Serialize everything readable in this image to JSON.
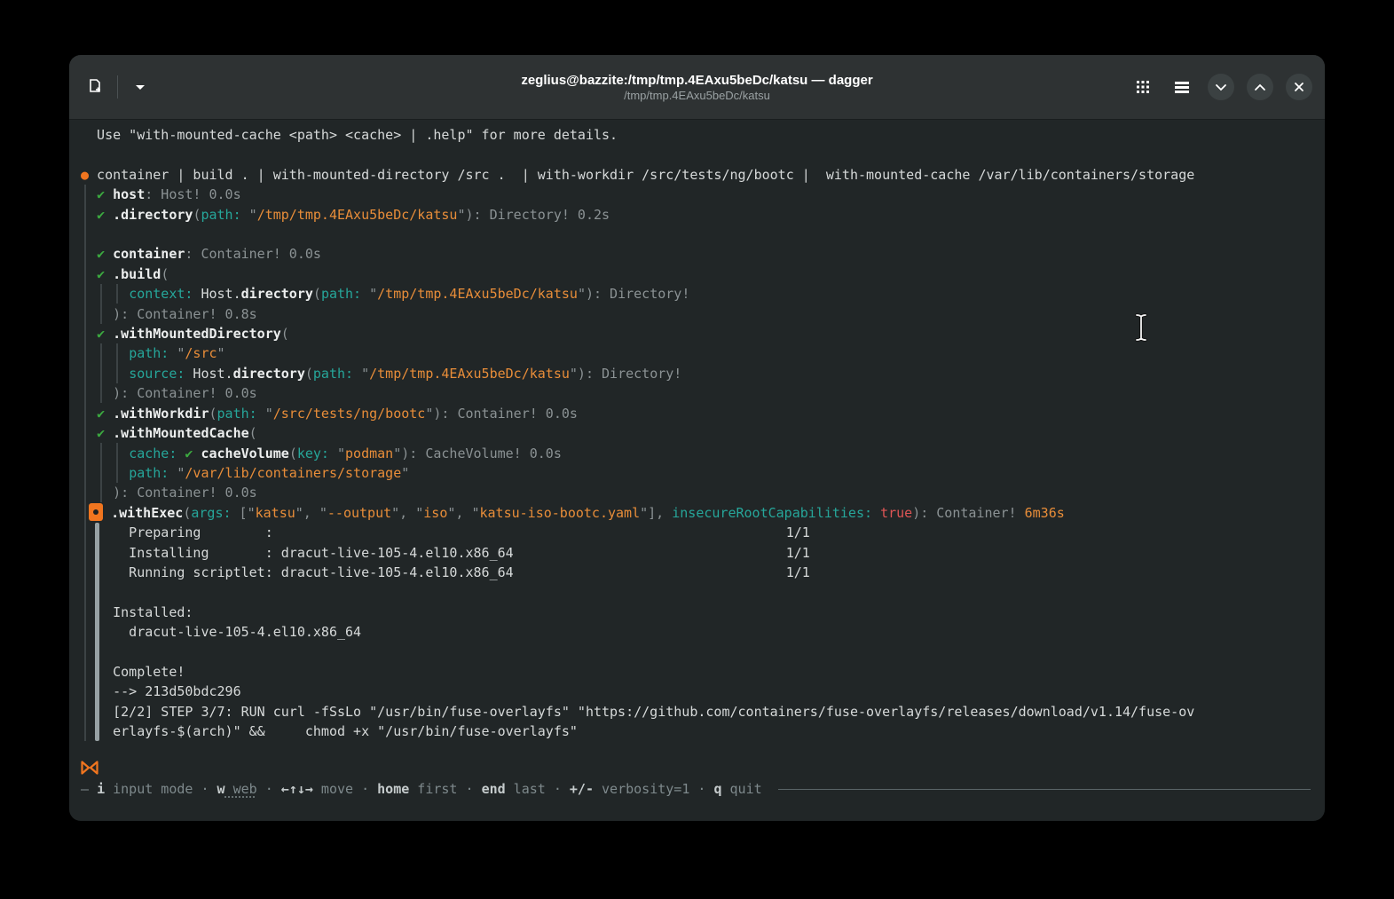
{
  "titlebar": {
    "title": "zeglius@bazzite:/tmp/tmp.4EAxu5beDc/katsu — dagger",
    "subtitle": "/tmp/tmp.4EAxu5beDc/katsu"
  },
  "colors": {
    "terminal_bg": "#212627",
    "titlebar_bg": "#2e3233",
    "fg_text": "#d6d9d9",
    "dim_text": "#8b9294",
    "teal": "#26a69a",
    "string_orange": "#e88d39",
    "accent_orange": "#f0751f",
    "green": "#3caa40",
    "red": "#de5555",
    "guide": "#3c4345",
    "guide_active": "#97a1a4",
    "status_key": "#c6cccd",
    "status_dim": "#7e898c"
  },
  "terminal": {
    "lines": [
      [
        {
          "t": "  Use \"with-mounted-cache <path> <cache> | .help\" for more details.",
          "c": "w"
        }
      ],
      [],
      [
        {
          "t": "●",
          "c": "o2"
        },
        {
          "t": " container | build . | with-mounted-directory /src .  | with-workdir /src/tests/ng/bootc |  with-mounted-cache /var/lib/containers/storage",
          "c": "w"
        }
      ],
      [
        {
          "t": "  ",
          "c": "w"
        },
        {
          "t": "✔ ",
          "c": "g"
        },
        {
          "t": "host",
          "c": "b"
        },
        {
          "t": ": Host! 0.0s",
          "c": "d"
        }
      ],
      [
        {
          "t": "  ",
          "c": "w"
        },
        {
          "t": "✔ ",
          "c": "g"
        },
        {
          "t": ".directory",
          "c": "b"
        },
        {
          "t": "(",
          "c": "d"
        },
        {
          "t": "path:",
          "c": "t"
        },
        {
          "t": " \"",
          "c": "d"
        },
        {
          "t": "/tmp/tmp.4EAxu5beDc/katsu",
          "c": "o"
        },
        {
          "t": "\"): Directory! 0.2s",
          "c": "d"
        }
      ],
      [],
      [
        {
          "t": "  ",
          "c": "w"
        },
        {
          "t": "✔ ",
          "c": "g"
        },
        {
          "t": "container",
          "c": "b"
        },
        {
          "t": ": Container! 0.0s",
          "c": "d"
        }
      ],
      [
        {
          "t": "  ",
          "c": "w"
        },
        {
          "t": "✔ ",
          "c": "g"
        },
        {
          "t": ".build",
          "c": "b"
        },
        {
          "t": "(",
          "c": "d"
        }
      ],
      [
        {
          "t": "      ",
          "c": "w"
        },
        {
          "t": "context:",
          "c": "t"
        },
        {
          "t": " Host.",
          "c": "w"
        },
        {
          "t": "directory",
          "c": "b"
        },
        {
          "t": "(",
          "c": "d"
        },
        {
          "t": "path:",
          "c": "t"
        },
        {
          "t": " \"",
          "c": "d"
        },
        {
          "t": "/tmp/tmp.4EAxu5beDc/katsu",
          "c": "o"
        },
        {
          "t": "\"): Directory!",
          "c": "d"
        }
      ],
      [
        {
          "t": "    ",
          "c": "w"
        },
        {
          "t": "): Container! 0.8s",
          "c": "d"
        }
      ],
      [
        {
          "t": "  ",
          "c": "w"
        },
        {
          "t": "✔ ",
          "c": "g"
        },
        {
          "t": ".withMountedDirectory",
          "c": "b"
        },
        {
          "t": "(",
          "c": "d"
        }
      ],
      [
        {
          "t": "      ",
          "c": "w"
        },
        {
          "t": "path:",
          "c": "t"
        },
        {
          "t": " \"",
          "c": "d"
        },
        {
          "t": "/src",
          "c": "o"
        },
        {
          "t": "\"",
          "c": "d"
        }
      ],
      [
        {
          "t": "      ",
          "c": "w"
        },
        {
          "t": "source:",
          "c": "t"
        },
        {
          "t": " Host.",
          "c": "w"
        },
        {
          "t": "directory",
          "c": "b"
        },
        {
          "t": "(",
          "c": "d"
        },
        {
          "t": "path:",
          "c": "t"
        },
        {
          "t": " \"",
          "c": "d"
        },
        {
          "t": "/tmp/tmp.4EAxu5beDc/katsu",
          "c": "o"
        },
        {
          "t": "\"): Directory!",
          "c": "d"
        }
      ],
      [
        {
          "t": "    ",
          "c": "w"
        },
        {
          "t": "): Container! 0.0s",
          "c": "d"
        }
      ],
      [
        {
          "t": "  ",
          "c": "w"
        },
        {
          "t": "✔ ",
          "c": "g"
        },
        {
          "t": ".withWorkdir",
          "c": "b"
        },
        {
          "t": "(",
          "c": "d"
        },
        {
          "t": "path:",
          "c": "t"
        },
        {
          "t": " \"",
          "c": "d"
        },
        {
          "t": "/src/tests/ng/bootc",
          "c": "o"
        },
        {
          "t": "\"): Container! 0.0s",
          "c": "d"
        }
      ],
      [
        {
          "t": "  ",
          "c": "w"
        },
        {
          "t": "✔ ",
          "c": "g"
        },
        {
          "t": ".withMountedCache",
          "c": "b"
        },
        {
          "t": "(",
          "c": "d"
        }
      ],
      [
        {
          "t": "      ",
          "c": "w"
        },
        {
          "t": "cache:",
          "c": "t"
        },
        {
          "t": " ",
          "c": "w"
        },
        {
          "t": "✔ ",
          "c": "g"
        },
        {
          "t": "cacheVolume",
          "c": "b"
        },
        {
          "t": "(",
          "c": "d"
        },
        {
          "t": "key:",
          "c": "t"
        },
        {
          "t": " \"",
          "c": "d"
        },
        {
          "t": "podman",
          "c": "o"
        },
        {
          "t": "\"): CacheVolume! 0.0s",
          "c": "d"
        }
      ],
      [
        {
          "t": "      ",
          "c": "w"
        },
        {
          "t": "path:",
          "c": "t"
        },
        {
          "t": " \"",
          "c": "d"
        },
        {
          "t": "/var/lib/containers/storage",
          "c": "o"
        },
        {
          "t": "\"",
          "c": "d"
        }
      ],
      [
        {
          "t": "    ",
          "c": "w"
        },
        {
          "t": "): Container! 0.0s",
          "c": "d"
        }
      ],
      [
        {
          "t": " ",
          "c": "w"
        },
        {
          "c": "m"
        },
        {
          "t": " ",
          "c": "w"
        },
        {
          "t": ".withExec",
          "c": "b"
        },
        {
          "t": "(",
          "c": "d"
        },
        {
          "t": "args:",
          "c": "t"
        },
        {
          "t": " [\"",
          "c": "d"
        },
        {
          "t": "katsu",
          "c": "o"
        },
        {
          "t": "\", \"",
          "c": "d"
        },
        {
          "t": "--output",
          "c": "o"
        },
        {
          "t": "\", \"",
          "c": "d"
        },
        {
          "t": "iso",
          "c": "o"
        },
        {
          "t": "\", \"",
          "c": "d"
        },
        {
          "t": "katsu-iso-bootc.yaml",
          "c": "o"
        },
        {
          "t": "\"], ",
          "c": "d"
        },
        {
          "t": "insecureRootCapabilities:",
          "c": "t"
        },
        {
          "t": " ",
          "c": "w"
        },
        {
          "t": "true",
          "c": "r"
        },
        {
          "t": "): Container! ",
          "c": "d"
        },
        {
          "t": "6m36s",
          "c": "o"
        }
      ],
      [
        {
          "t": "      Preparing        :                                                                1/1",
          "c": "w"
        }
      ],
      [
        {
          "t": "      Installing       : dracut-live-105-4.el10.x86_64                                  1/1",
          "c": "w"
        }
      ],
      [
        {
          "t": "      Running scriptlet: dracut-live-105-4.el10.x86_64                                  1/1",
          "c": "w"
        }
      ],
      [],
      [
        {
          "t": "    Installed:",
          "c": "w"
        }
      ],
      [
        {
          "t": "      dracut-live-105-4.el10.x86_64",
          "c": "w"
        }
      ],
      [],
      [
        {
          "t": "    Complete!",
          "c": "w"
        }
      ],
      [
        {
          "t": "    --> 213d50bdc296",
          "c": "w"
        }
      ],
      [
        {
          "t": "    [2/2] STEP 3/7: RUN curl -fSsLo \"/usr/bin/fuse-overlayfs\" \"https://github.com/containers/fuse-overlayfs/releases/download/v1.14/fuse-ov",
          "c": "w"
        }
      ],
      [
        {
          "t": "    erlayfs-$(arch)\" &&     chmod +x \"/usr/bin/fuse-overlayfs\"",
          "c": "w"
        }
      ]
    ]
  },
  "statusbar": {
    "leading_dash": "— ",
    "separator": " · ",
    "trailing_space": " ",
    "items": [
      {
        "key": "i",
        "label": "input mode"
      },
      {
        "key": "w",
        "label": "web",
        "underline": true
      },
      {
        "key": "←↑↓→",
        "label": "move"
      },
      {
        "key": "home",
        "label": "first"
      },
      {
        "key": "end",
        "label": "last"
      },
      {
        "key": "+/-",
        "label": "verbosity=1"
      },
      {
        "key": "q",
        "label": "quit"
      }
    ]
  }
}
